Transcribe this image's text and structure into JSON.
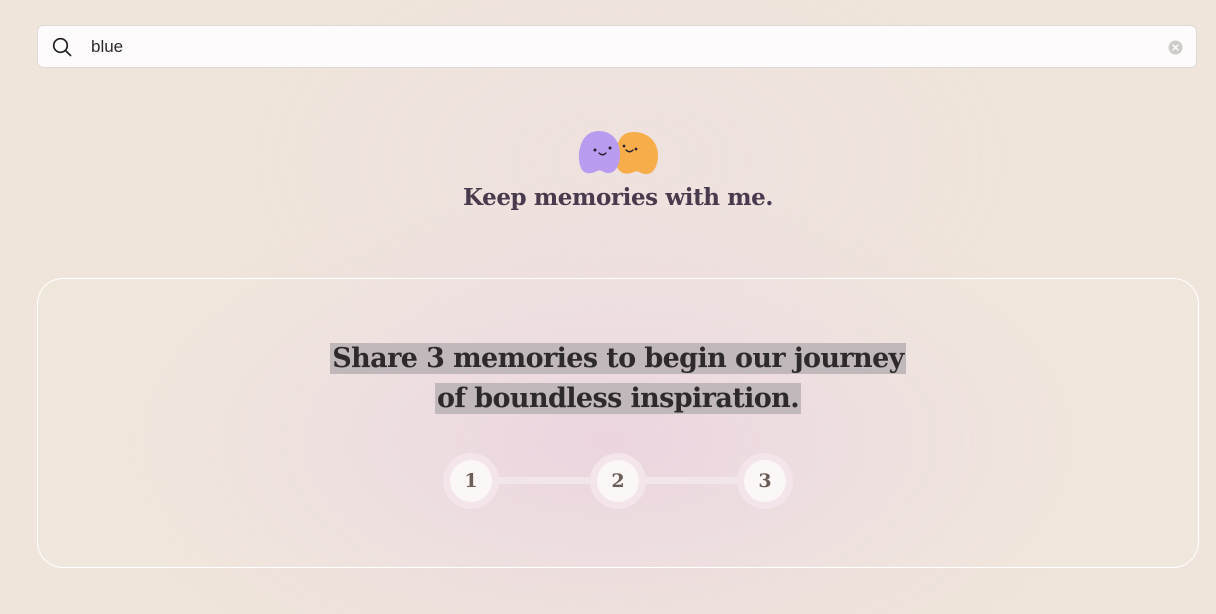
{
  "search": {
    "value": "blue",
    "icon": "search-icon",
    "clear_icon": "clear-icon"
  },
  "brand": {
    "logo": "two-blob-characters-logo",
    "colors": {
      "purple_blob": "#b99cf0",
      "orange_blob": "#f7ae4a"
    },
    "tagline": "Keep memories with me."
  },
  "onboarding": {
    "headline_line1": "Share 3 memories to begin our journey",
    "headline_line2": "of boundless inspiration.",
    "steps": [
      {
        "label": "1"
      },
      {
        "label": "2"
      },
      {
        "label": "3"
      }
    ]
  }
}
